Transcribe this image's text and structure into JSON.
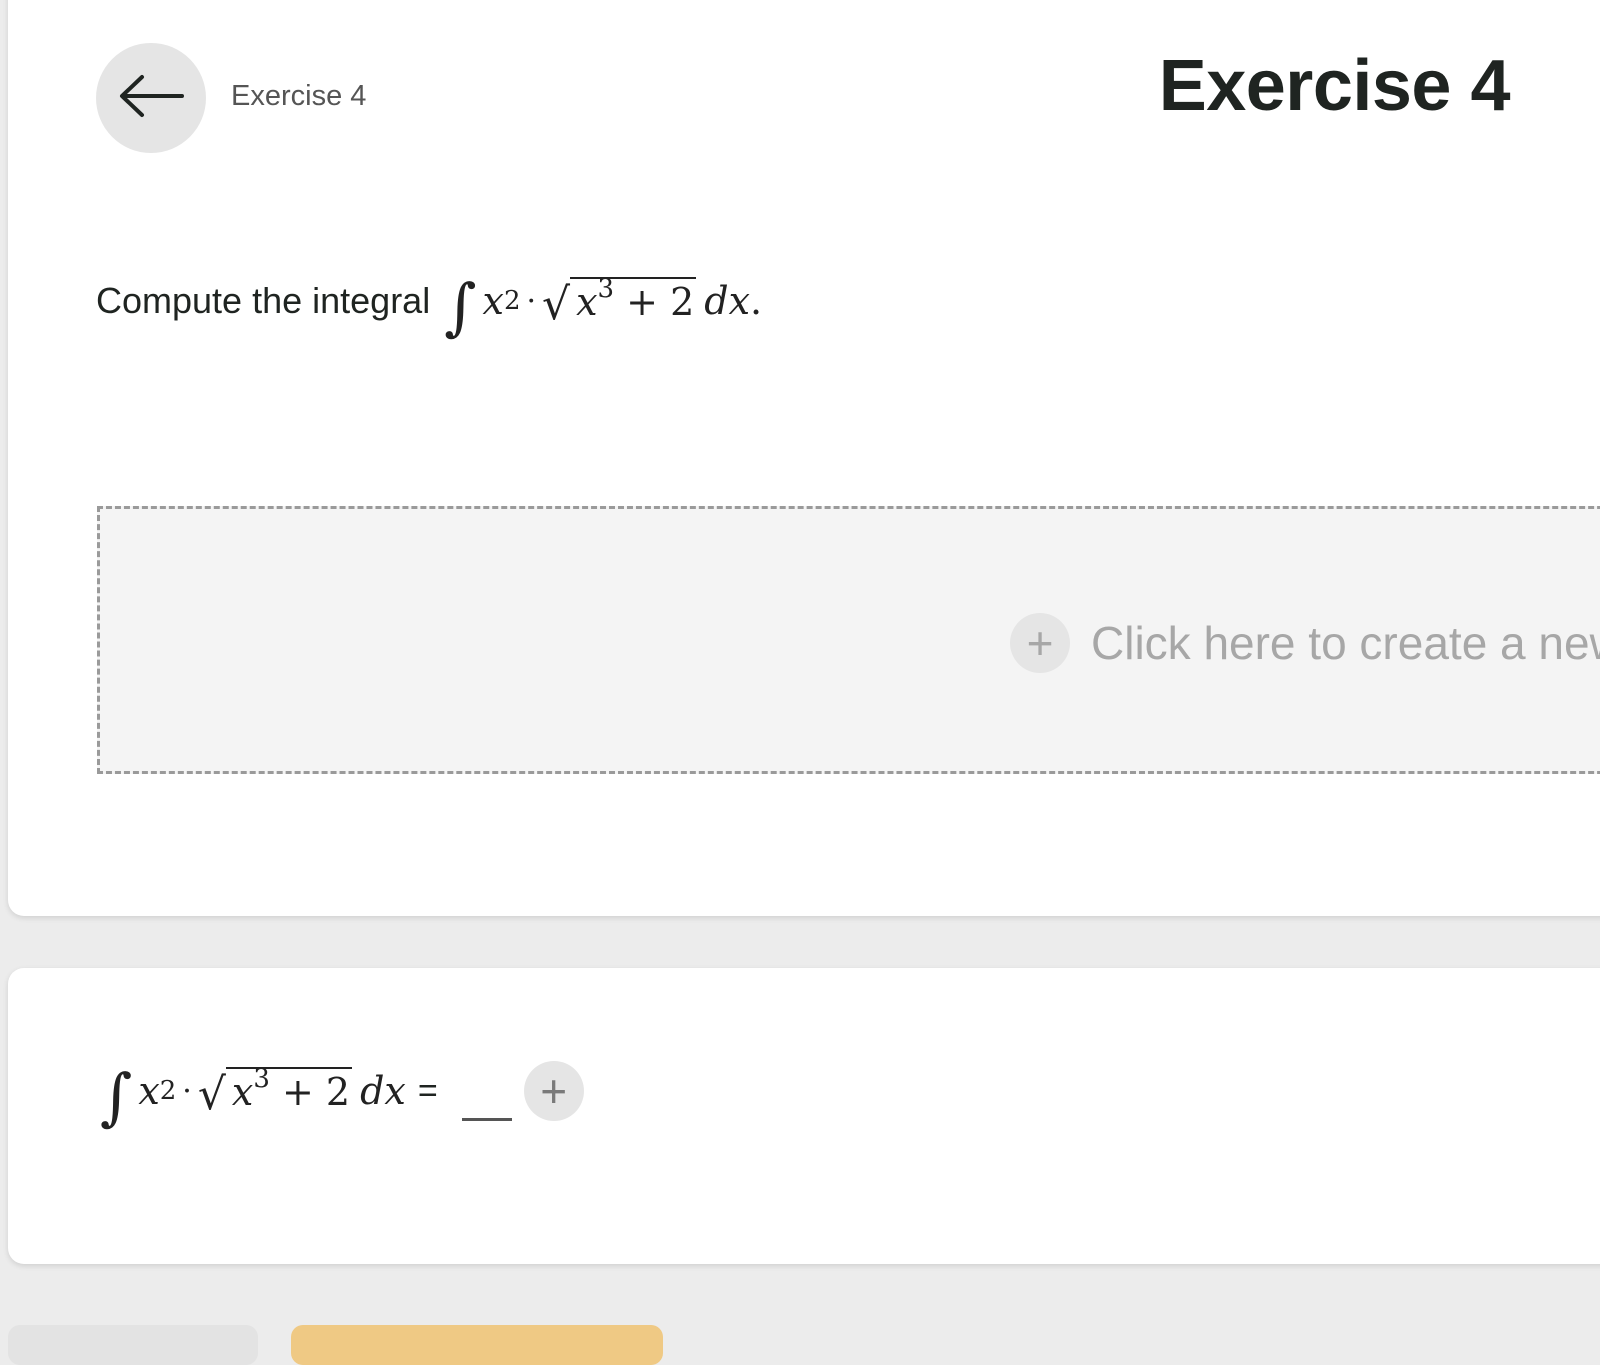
{
  "header": {
    "breadcrumb": "Exercise 4",
    "title": "Exercise 4",
    "back_icon": "arrow-left-icon"
  },
  "question": {
    "prompt": "Compute the integral",
    "integral_sign": "∫",
    "base": "x",
    "exp1": "2",
    "dot": "·",
    "radical": "√",
    "exp2": "3",
    "plus_const": "+ 2",
    "differential": "dx",
    "period": "."
  },
  "dropzone": {
    "icon": "plus-icon",
    "icon_glyph": "+",
    "text": "Click here to create a new"
  },
  "answer": {
    "equals": "=",
    "add_glyph": "+",
    "add_icon": "plus-icon"
  },
  "colors": {
    "background": "#ececec",
    "card": "#ffffff",
    "accent": "#efc984",
    "muted_text": "#a7a7a7"
  }
}
